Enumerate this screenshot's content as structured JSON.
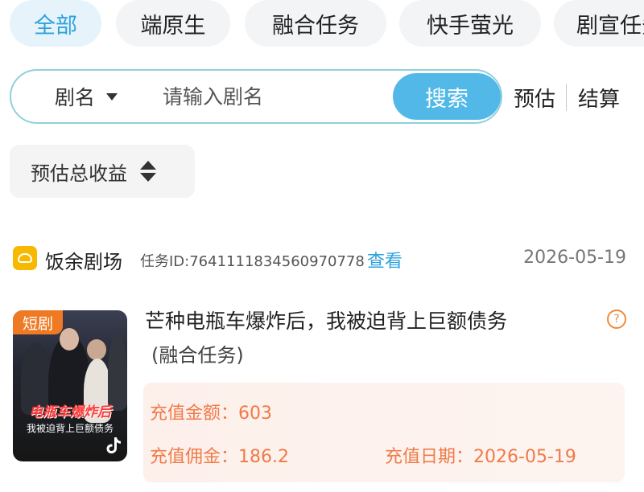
{
  "tabs": [
    {
      "label": "全部",
      "active": true
    },
    {
      "label": "端原生",
      "active": false
    },
    {
      "label": "融合任务",
      "active": false
    },
    {
      "label": "快手萤光",
      "active": false
    },
    {
      "label": "剧宣任务",
      "active": false
    }
  ],
  "search": {
    "field_label": "剧名",
    "placeholder": "请输入剧名",
    "button_label": "搜索"
  },
  "modes": {
    "estimate": "预估",
    "settle": "结算"
  },
  "sort": {
    "label": "预估总收益"
  },
  "order": {
    "platform": "饭余剧场",
    "task_id": "任务ID:7641111834560970778",
    "view_label": "查看",
    "date": "2026-05-19",
    "poster_tag": "短剧",
    "poster_title": "电瓶车爆炸后",
    "poster_subtitle": "我被迫背上巨额债务",
    "title": "芒种电瓶车爆炸后，我被迫背上巨额债务",
    "subtitle": "(融合任务)",
    "recharge_amount_label": "充值金额：",
    "recharge_amount": "603",
    "commission_label": "充值佣金：",
    "commission": "186.2",
    "recharge_date_label": "充值日期：",
    "recharge_date": "2026-05-19"
  },
  "colors": {
    "accent": "#2ea2dc",
    "search_button": "#52b8e8",
    "orange": "#f07a48",
    "platform_icon": "#f7b900"
  }
}
